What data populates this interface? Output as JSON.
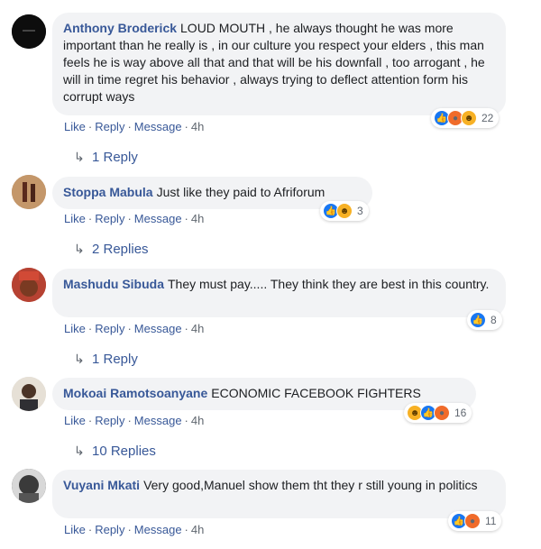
{
  "actions": {
    "like": "Like",
    "reply": "Reply",
    "message": "Message",
    "sep": "·"
  },
  "comments": [
    {
      "author": "Anthony Broderick",
      "text": "LOUD MOUTH , he always thought he was more important than he really is , in our culture you respect your elders , this man feels he is way above all that and that will be his downfall , too arrogant , he will in time regret his behavior , always trying to deflect attention form his corrupt ways",
      "time": "4h",
      "reactions_count": "22",
      "reactions": [
        "like-icon",
        "angry-icon",
        "haha-icon"
      ],
      "replies": "1 Reply"
    },
    {
      "author": "Stoppa Mabula",
      "text": "Just like they paid to Afriforum",
      "time": "4h",
      "reactions_count": "3",
      "reactions": [
        "like-icon",
        "haha-icon"
      ],
      "replies": "2 Replies"
    },
    {
      "author": "Mashudu Sibuda",
      "text": "They must pay..... They think they are best in this country.",
      "time": "4h",
      "reactions_count": "8",
      "reactions": [
        "like-icon"
      ],
      "replies": "1 Reply"
    },
    {
      "author": "Mokoai Ramotsoanyane",
      "text": "ECONOMIC FACEBOOK FIGHTERS",
      "time": "4h",
      "reactions_count": "16",
      "reactions": [
        "haha-icon",
        "like-icon",
        "angry-icon"
      ],
      "replies": "10 Replies"
    },
    {
      "author": "Vuyani Mkati",
      "text": "Very good,Manuel show them tht they r still young in politics",
      "time": "4h",
      "reactions_count": "11",
      "reactions": [
        "like-icon",
        "angry-icon"
      ],
      "replies": ""
    }
  ],
  "colors": {
    "link": "#385898",
    "bubble": "#f2f3f5",
    "meta": "#606770"
  }
}
